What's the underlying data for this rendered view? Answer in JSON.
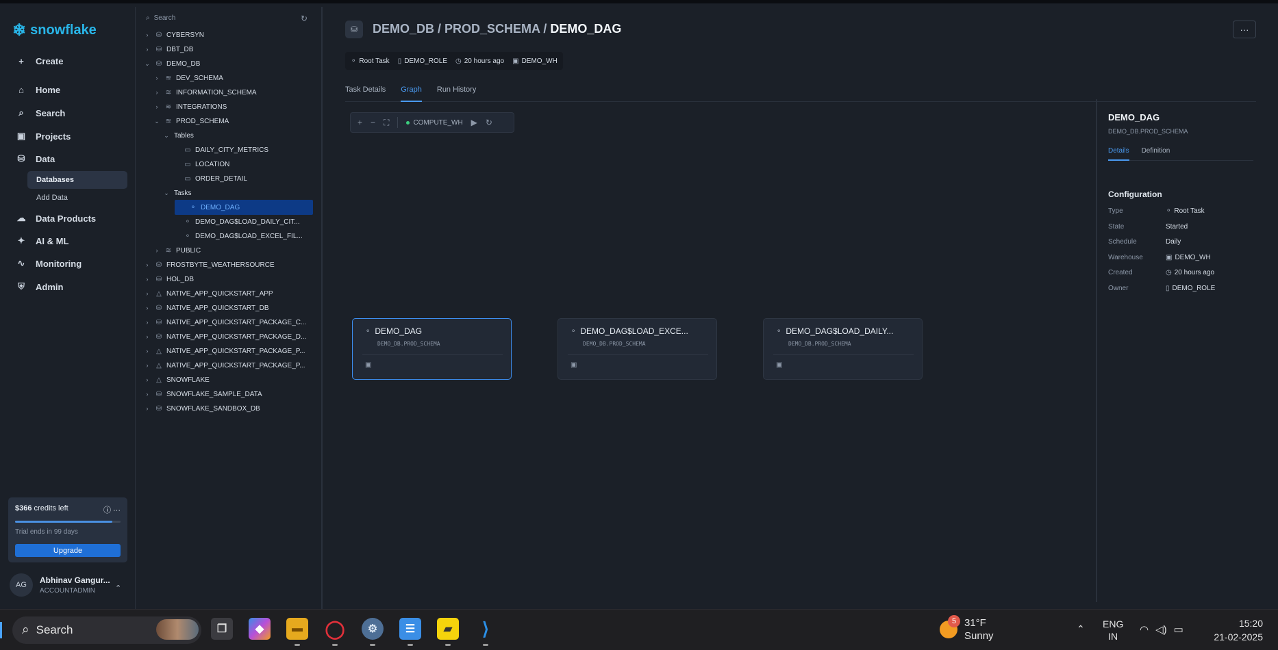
{
  "brand": {
    "name": "snowflake",
    "color": "#29b5e8"
  },
  "nav": {
    "create": "Create",
    "items": [
      {
        "label": "Home",
        "icon": "home-icon"
      },
      {
        "label": "Search",
        "icon": "search-icon"
      },
      {
        "label": "Projects",
        "icon": "projects-icon"
      },
      {
        "label": "Data",
        "icon": "database-icon"
      },
      {
        "label": "Data Products",
        "icon": "cloud-icon"
      },
      {
        "label": "AI & ML",
        "icon": "sparkle-icon"
      },
      {
        "label": "Monitoring",
        "icon": "pulse-icon"
      },
      {
        "label": "Admin",
        "icon": "shield-icon"
      }
    ],
    "data_sub": [
      "Databases",
      "Add Data"
    ]
  },
  "credits": {
    "amount": "$366",
    "suffix": "credits left",
    "trial": "Trial ends in 99 days",
    "upgrade": "Upgrade",
    "progress": 0.92
  },
  "user": {
    "initials": "AG",
    "name": "Abhinav Gangur...",
    "role": "ACCOUNTADMIN"
  },
  "tree": {
    "search_placeholder": "Search",
    "rows": [
      {
        "label": "CYBERSYN",
        "caret": "›",
        "icon": "⛁"
      },
      {
        "label": "DBT_DB",
        "caret": "›",
        "icon": "⛁"
      },
      {
        "label": "DEMO_DB",
        "caret": "⌄",
        "icon": "⛁"
      },
      {
        "label": "DEV_SCHEMA",
        "caret": "›",
        "icon": "≋"
      },
      {
        "label": "INFORMATION_SCHEMA",
        "caret": "›",
        "icon": "≋"
      },
      {
        "label": "INTEGRATIONS",
        "caret": "›",
        "icon": "≋"
      },
      {
        "label": "PROD_SCHEMA",
        "caret": "⌄",
        "icon": "≋"
      },
      {
        "label": "Tables",
        "caret": "⌄",
        "icon": ""
      },
      {
        "label": "DAILY_CITY_METRICS",
        "caret": "",
        "icon": "▭"
      },
      {
        "label": "LOCATION",
        "caret": "",
        "icon": "▭"
      },
      {
        "label": "ORDER_DETAIL",
        "caret": "",
        "icon": "▭"
      },
      {
        "label": "Tasks",
        "caret": "⌄",
        "icon": ""
      },
      {
        "label": "DEMO_DAG",
        "caret": "",
        "icon": "⚬"
      },
      {
        "label": "DEMO_DAG$LOAD_DAILY_CIT...",
        "caret": "",
        "icon": "⚬"
      },
      {
        "label": "DEMO_DAG$LOAD_EXCEL_FIL...",
        "caret": "",
        "icon": "⚬"
      },
      {
        "label": "PUBLIC",
        "caret": "›",
        "icon": "≋"
      },
      {
        "label": "FROSTBYTE_WEATHERSOURCE",
        "caret": "›",
        "icon": "⛁"
      },
      {
        "label": "HOL_DB",
        "caret": "›",
        "icon": "⛁"
      },
      {
        "label": "NATIVE_APP_QUICKSTART_APP",
        "caret": "›",
        "icon": "△"
      },
      {
        "label": "NATIVE_APP_QUICKSTART_DB",
        "caret": "›",
        "icon": "⛁"
      },
      {
        "label": "NATIVE_APP_QUICKSTART_PACKAGE_C...",
        "caret": "›",
        "icon": "⛁"
      },
      {
        "label": "NATIVE_APP_QUICKSTART_PACKAGE_D...",
        "caret": "›",
        "icon": "⛁"
      },
      {
        "label": "NATIVE_APP_QUICKSTART_PACKAGE_P...",
        "caret": "›",
        "icon": "△"
      },
      {
        "label": "NATIVE_APP_QUICKSTART_PACKAGE_P...",
        "caret": "›",
        "icon": "△"
      },
      {
        "label": "SNOWFLAKE",
        "caret": "›",
        "icon": "△"
      },
      {
        "label": "SNOWFLAKE_SAMPLE_DATA",
        "caret": "›",
        "icon": "⛁"
      },
      {
        "label": "SNOWFLAKE_SANDBOX_DB",
        "caret": "›",
        "icon": "⛁"
      }
    ]
  },
  "breadcrumb": {
    "db": "DEMO_DB",
    "schema": "PROD_SCHEMA",
    "task": "DEMO_DAG",
    "sep": " / "
  },
  "meta": {
    "type": "Root Task",
    "role": "DEMO_ROLE",
    "created": "20 hours ago",
    "warehouse": "DEMO_WH"
  },
  "tabs": [
    "Task Details",
    "Graph",
    "Run History"
  ],
  "toolbar": {
    "warehouse": "COMPUTE_WH"
  },
  "graph": {
    "nodes": [
      {
        "title": "DEMO_DAG",
        "schema": "DEMO_DB.PROD_SCHEMA"
      },
      {
        "title": "DEMO_DAG$LOAD_EXCE...",
        "schema": "DEMO_DB.PROD_SCHEMA"
      },
      {
        "title": "DEMO_DAG$LOAD_DAILY...",
        "schema": "DEMO_DB.PROD_SCHEMA"
      }
    ]
  },
  "panel": {
    "title": "DEMO_DAG",
    "subtitle": "DEMO_DB.PROD_SCHEMA",
    "tabs": [
      "Details",
      "Definition"
    ],
    "section": "Configuration",
    "rows": [
      {
        "key": "Type",
        "value": "Root Task",
        "icon": "⚬"
      },
      {
        "key": "State",
        "value": "Started",
        "icon": ""
      },
      {
        "key": "Schedule",
        "value": "Daily",
        "icon": ""
      },
      {
        "key": "Warehouse",
        "value": "DEMO_WH",
        "icon": "▣"
      },
      {
        "key": "Created",
        "value": "20 hours ago",
        "icon": "◷"
      },
      {
        "key": "Owner",
        "value": "DEMO_ROLE",
        "icon": "▯"
      }
    ]
  },
  "taskbar": {
    "search": "Search",
    "weather_temp": "31°F",
    "weather_desc": "Sunny",
    "weather_badge": "5",
    "lang1": "ENG",
    "lang2": "IN",
    "time": "15:20",
    "date": "21-02-2025"
  }
}
